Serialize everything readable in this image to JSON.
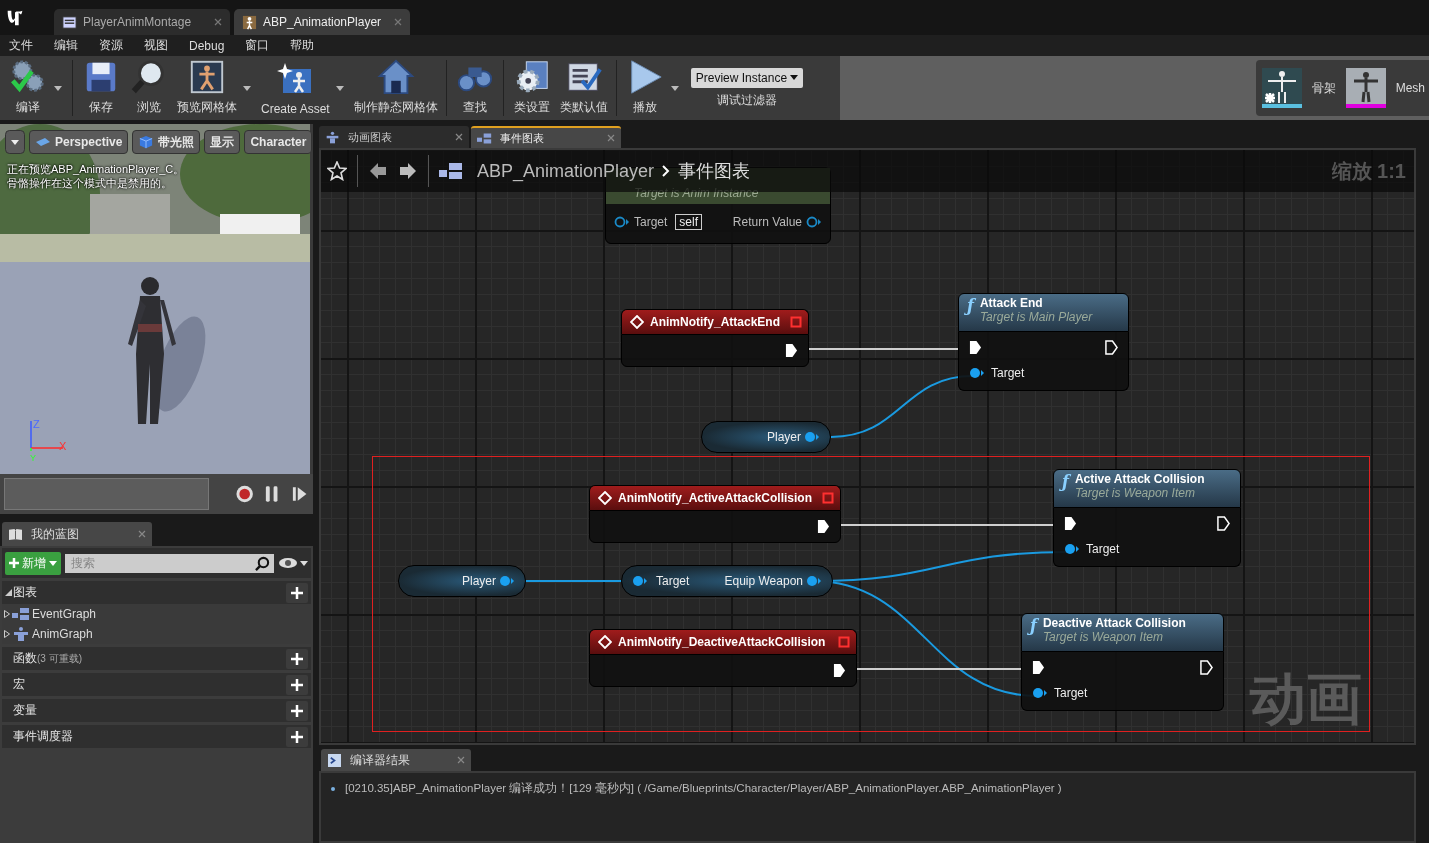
{
  "tabs": [
    {
      "label": "PlayerAnimMontage",
      "kind": "montage",
      "selected": false
    },
    {
      "label": "ABP_AnimationPlayer",
      "kind": "animbp",
      "selected": true
    }
  ],
  "menu": [
    "文件",
    "编辑",
    "资源",
    "视图",
    "Debug",
    "窗口",
    "帮助"
  ],
  "toolbar": [
    {
      "label": "编译",
      "kind": "compile",
      "dropdown": true
    },
    {
      "label": "保存",
      "kind": "save",
      "dropdown": false
    },
    {
      "label": "浏览",
      "kind": "browse",
      "dropdown": false
    },
    {
      "label": "预览网格体",
      "kind": "preview",
      "dropdown": true
    },
    {
      "label": "Create Asset",
      "kind": "create",
      "dropdown": true
    },
    {
      "label": "制作静态网格体",
      "kind": "static",
      "dropdown": false
    },
    {
      "label": "查找",
      "kind": "find",
      "dropdown": false
    },
    {
      "label": "类设置",
      "kind": "settings",
      "dropdown": false
    },
    {
      "label": "类默认值",
      "kind": "defaults",
      "dropdown": false
    },
    {
      "label": "播放",
      "kind": "play",
      "dropdown": true
    }
  ],
  "debug_filter": {
    "value": "Preview Instance",
    "label": "调试过滤器"
  },
  "assets": [
    {
      "label": "骨架",
      "kind": "skeleton"
    },
    {
      "label": "Mesh",
      "kind": "mesh"
    }
  ],
  "viewport": {
    "buttons": [
      {
        "label": "Perspective",
        "kind": "perspective"
      },
      {
        "label": "带光照",
        "kind": "lit"
      },
      {
        "label": "显示",
        "kind": "plain"
      },
      {
        "label": "Character",
        "kind": "plain"
      }
    ],
    "notice": [
      "正在预览ABP_AnimationPlayer_C。",
      "骨骼操作在这个模式中是禁用的。"
    ],
    "axes": [
      "Z",
      "X",
      "Y"
    ]
  },
  "my_blueprint": {
    "tab": "我的蓝图",
    "new_button": "新增",
    "search": {
      "placeholder": "搜索"
    },
    "sections": [
      {
        "label": "图表",
        "expanded": true,
        "items": [
          {
            "label": "EventGraph",
            "kind": "event",
            "expanded": false
          },
          {
            "label": "AnimGraph",
            "kind": "anim",
            "expanded": false
          }
        ]
      },
      {
        "label": "函数",
        "count": "(3 可重载)",
        "expanded": false
      },
      {
        "label": "宏",
        "expanded": false
      },
      {
        "label": "变量",
        "expanded": false
      },
      {
        "label": "事件调度器",
        "expanded": false
      }
    ]
  },
  "doc_tabs": [
    {
      "label": "动画图表",
      "kind": "anim",
      "selected": false
    },
    {
      "label": "事件图表",
      "kind": "event",
      "selected": true
    }
  ],
  "graph": {
    "breadcrumb": [
      "ABP_AnimationPlayer",
      "事件图表"
    ],
    "zoom": "缩放 1:1",
    "watermark": "动画",
    "nodes": [
      {
        "kind": "partial",
        "subtitle": "Target is Anim Instance",
        "input": "Target",
        "default": "self",
        "output": "Return Value"
      },
      {
        "kind": "event",
        "title": "AnimNotify_AttackEnd"
      },
      {
        "kind": "function",
        "icon": "ƒ",
        "title": "Attack End",
        "subtitle": "Target is Main Player",
        "input": "Target"
      },
      {
        "kind": "variable",
        "title": "Player"
      },
      {
        "kind": "event",
        "title": "AnimNotify_ActiveAttackCollision"
      },
      {
        "kind": "function",
        "icon": "ƒ",
        "title": "Active Attack Collision",
        "subtitle": "Target is Weapon Item",
        "input": "Target"
      },
      {
        "kind": "variable",
        "title": "Player"
      },
      {
        "kind": "getter",
        "input": "Target",
        "output": "Equip Weapon"
      },
      {
        "kind": "event",
        "title": "AnimNotify_DeactiveAttackCollision"
      },
      {
        "kind": "function",
        "icon": "ƒ",
        "title": "Deactive Attack Collision",
        "subtitle": "Target is Weapon Item",
        "input": "Target"
      }
    ]
  },
  "compiler": {
    "tab": "编译器结果",
    "messages": [
      "[0210.35]ABP_AnimationPlayer 编译成功！[129 毫秒内] ( /Game/Blueprints/Character/Player/ABP_AnimationPlayer.ABP_AnimationPlayer )"
    ]
  }
}
